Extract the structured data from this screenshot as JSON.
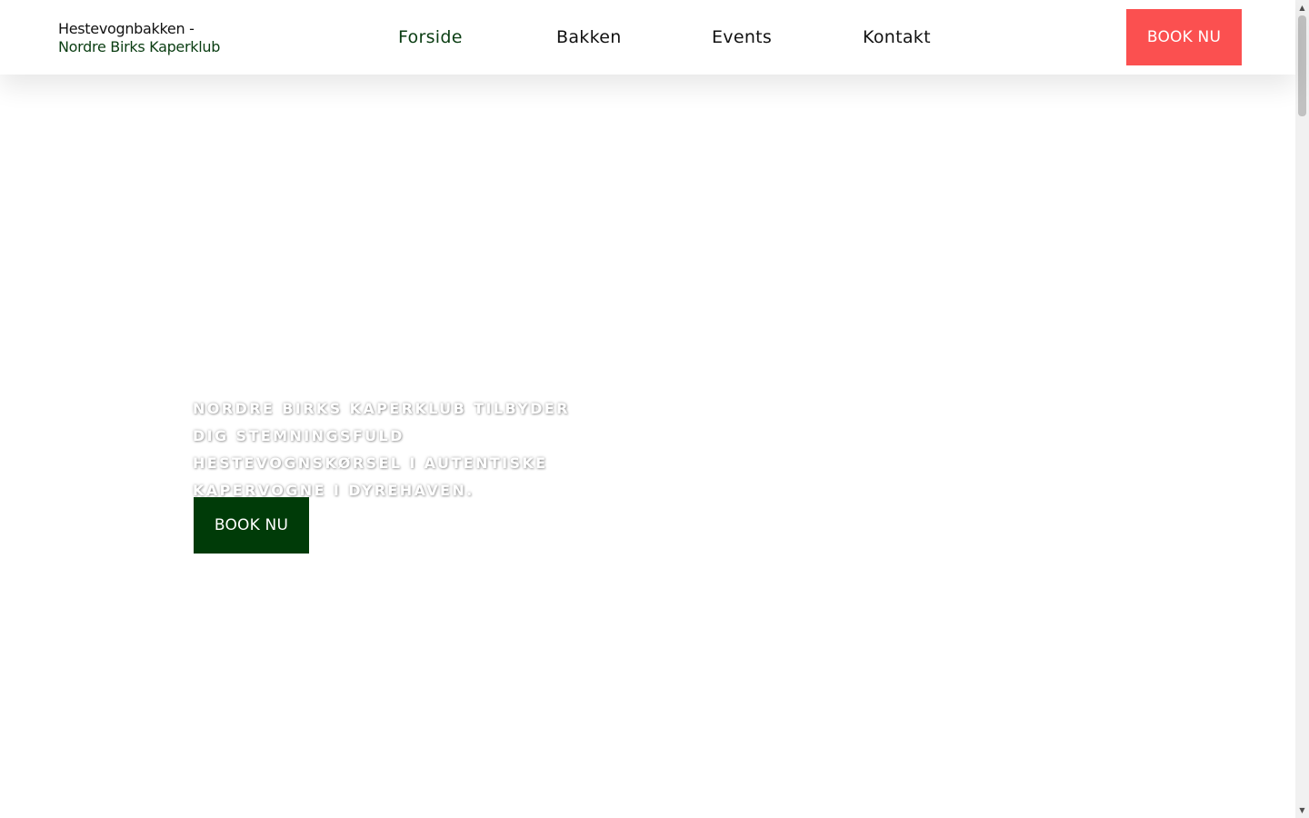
{
  "header": {
    "logo": {
      "line1": "Hestevognbakken -",
      "line2": "Nordre Birks Kaperklub"
    },
    "nav": [
      {
        "label": "Forside",
        "active": true
      },
      {
        "label": "Bakken",
        "active": false
      },
      {
        "label": "Events",
        "active": false
      },
      {
        "label": "Kontakt",
        "active": false
      }
    ],
    "book_label": "BOOK NU"
  },
  "hero": {
    "text": "NORDRE BIRKS KAPERKLUB TILBYDER DIG STEMNINGSFULD HESTEVOGNSKØRSEL I AUTENTISKE KAPERVOGNE I DYREHAVEN.",
    "book_label": "BOOK NU"
  },
  "scrollbar": {
    "up_arrow": "▲",
    "down_arrow": "▼"
  },
  "colors": {
    "brand_green": "#0a3d12",
    "hero_button": "#003b08",
    "header_button": "#fb5050",
    "text": "#111111"
  }
}
